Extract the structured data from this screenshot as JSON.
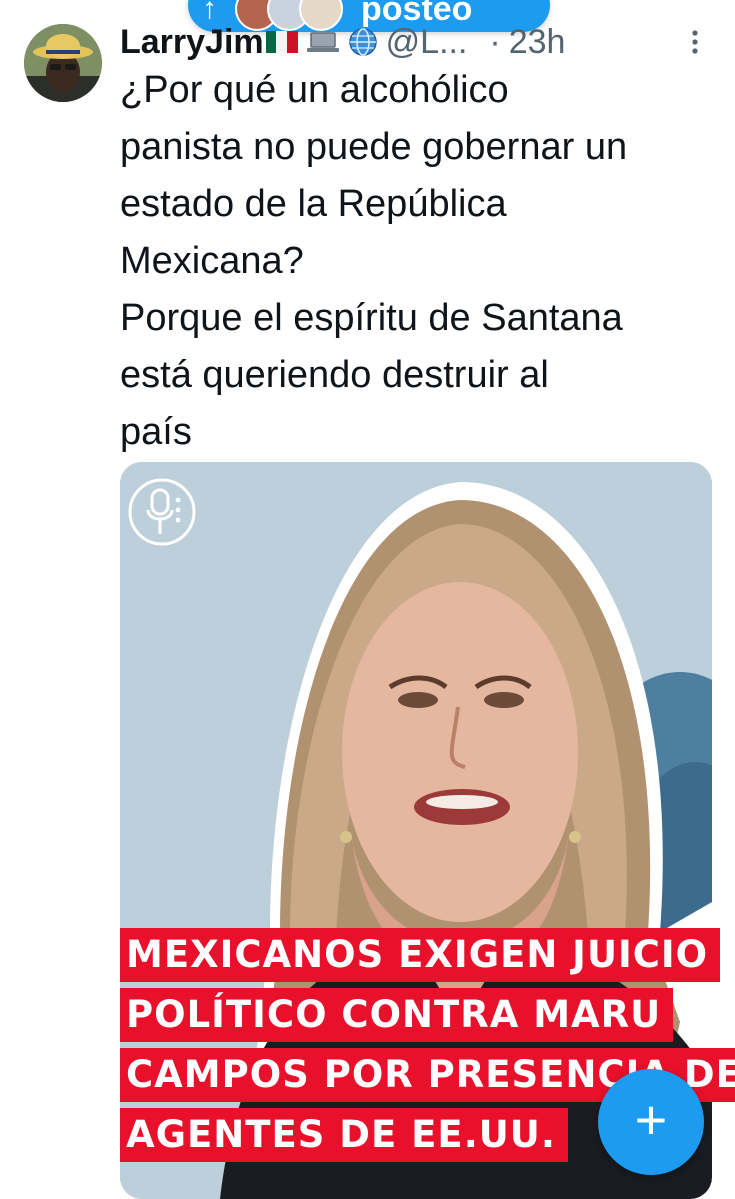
{
  "new_posts_pill": {
    "label": "posteo"
  },
  "post": {
    "author_name": "LarryJim",
    "handle": "@L...",
    "separator": "·",
    "time": "23h",
    "text_lines": [
      "¿Por qué un alcohólico",
      "panista no puede gobernar un",
      "estado de la República",
      "Mexicana?",
      "Porque el espíritu de Santana",
      "está queriendo destruir al",
      "país"
    ],
    "media": {
      "headline_lines": [
        "MEXICANOS EXIGEN JUICIO",
        "POLÍTICO CONTRA MARU",
        "CAMPOS POR PRESENCIA DE",
        "AGENTES DE EE.UU."
      ]
    }
  },
  "compose_button": {
    "symbol": "+"
  },
  "colors": {
    "accent": "#1d9bf0",
    "headline_red": "#e8102a",
    "secondary_text": "#536471"
  },
  "icons": [
    "arrow-up-icon",
    "mexico-flag-icon",
    "laptop-icon",
    "globe-icon",
    "more-icon",
    "microphone-logo-icon",
    "plus-icon"
  ]
}
